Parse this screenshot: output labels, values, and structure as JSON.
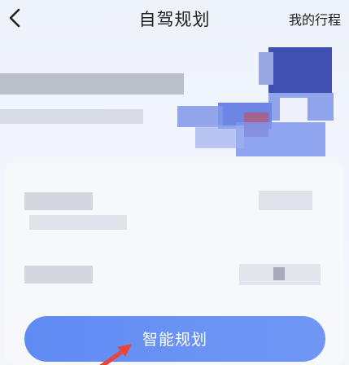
{
  "header": {
    "title": "自驾规划",
    "my_trips_label": "我的行程"
  },
  "main": {
    "banner": {
      "content": "censored"
    },
    "form_rows": [
      {
        "label": "",
        "value": ""
      },
      {
        "label": "",
        "value": ""
      }
    ],
    "plan_button_label": "智能规划"
  },
  "colors": {
    "button": "#6a93f4",
    "annotation_arrow": "#e8463c"
  },
  "icons": {
    "back": "chevron-left-icon",
    "annotation": "red-arrow-icon"
  }
}
